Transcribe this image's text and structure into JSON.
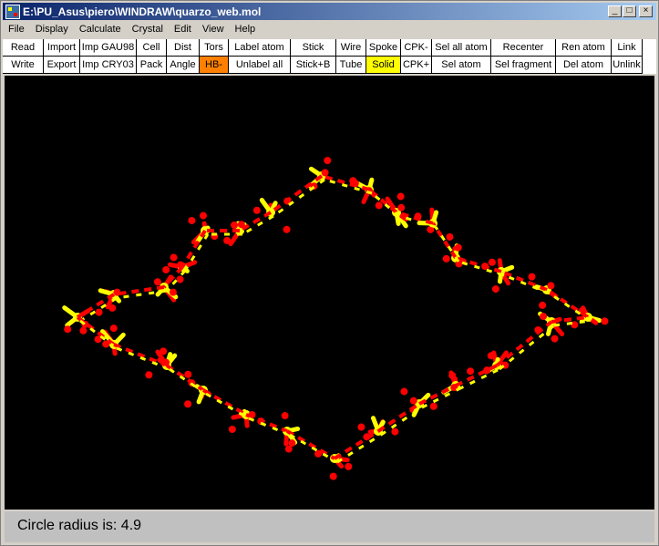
{
  "window": {
    "title": "E:\\PU_Asus\\piero\\WINDRAW\\quarzo_web.mol"
  },
  "menu": [
    "File",
    "Display",
    "Calculate",
    "Crystal",
    "Edit",
    "View",
    "Help"
  ],
  "toolbar": {
    "row1": [
      {
        "label": "Read",
        "w": 45
      },
      {
        "label": "Import",
        "w": 40
      },
      {
        "label": "Imp GAU98",
        "w": 62
      },
      {
        "label": "Cell",
        "w": 33
      },
      {
        "label": "Dist",
        "w": 36
      },
      {
        "label": "Tors",
        "w": 32
      },
      {
        "label": "Label atom",
        "w": 68
      },
      {
        "label": "Stick",
        "w": 50
      },
      {
        "label": "Wire",
        "w": 33
      },
      {
        "label": "Spoke",
        "w": 38
      },
      {
        "label": "CPK-",
        "w": 34
      },
      {
        "label": "Sel all atom",
        "w": 65
      },
      {
        "label": "Recenter",
        "w": 71
      },
      {
        "label": "Ren atom",
        "w": 61
      },
      {
        "label": "Link",
        "w": 34
      }
    ],
    "row2": [
      {
        "label": "Write",
        "w": 45
      },
      {
        "label": "Export",
        "w": 40
      },
      {
        "label": "Imp CRY03",
        "w": 62
      },
      {
        "label": "Pack",
        "w": 33
      },
      {
        "label": "Angle",
        "w": 36
      },
      {
        "label": "HB-",
        "w": 32,
        "hl": "orange"
      },
      {
        "label": "Unlabel all",
        "w": 68
      },
      {
        "label": "Stick+B",
        "w": 50
      },
      {
        "label": "Tube",
        "w": 33
      },
      {
        "label": "Solid",
        "w": 38,
        "hl": "yellow"
      },
      {
        "label": "CPK+",
        "w": 34
      },
      {
        "label": "Sel atom",
        "w": 65
      },
      {
        "label": "Sel fragment",
        "w": 71
      },
      {
        "label": "Del atom",
        "w": 61
      },
      {
        "label": "Unlink",
        "w": 34
      }
    ]
  },
  "colors": {
    "oxygen": "#ff0000",
    "silicon": "#ffff00",
    "background": "#000000"
  },
  "status": {
    "text": "Circle radius is: 4.9"
  }
}
